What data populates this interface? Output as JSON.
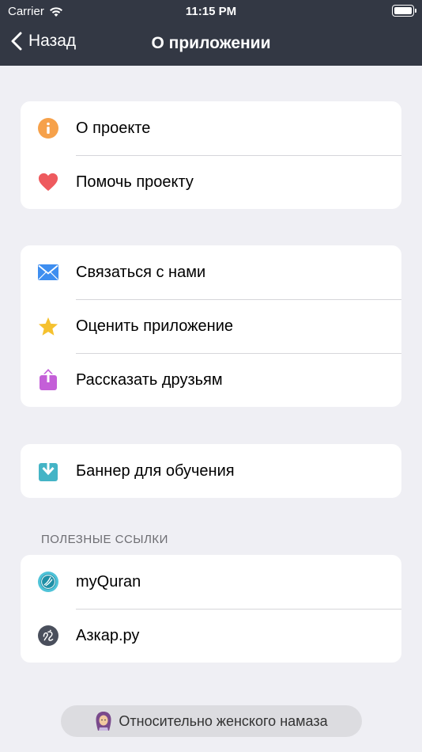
{
  "status_bar": {
    "carrier": "Carrier",
    "time": "11:15 PM"
  },
  "nav": {
    "back_label": "Назад",
    "title": "О приложении"
  },
  "groups": [
    {
      "items": [
        {
          "label": "О проекте",
          "icon": "info-icon"
        },
        {
          "label": "Помочь проекту",
          "icon": "heart-icon"
        }
      ]
    },
    {
      "items": [
        {
          "label": "Связаться с нами",
          "icon": "mail-icon"
        },
        {
          "label": "Оценить приложение",
          "icon": "star-icon"
        },
        {
          "label": "Рассказать друзьям",
          "icon": "share-icon"
        }
      ]
    },
    {
      "items": [
        {
          "label": "Баннер для обучения",
          "icon": "download-icon"
        }
      ]
    }
  ],
  "useful_links": {
    "header": "ПОЛЕЗНЫЕ ССЫЛКИ",
    "items": [
      {
        "label": "myQuran",
        "icon": "myquran-icon"
      },
      {
        "label": "Азкар.ру",
        "icon": "azkar-icon"
      }
    ]
  },
  "footer_button": {
    "label": "Относительно женского намаза",
    "icon": "woman-hijab-icon"
  },
  "colors": {
    "nav_bg": "#333844",
    "info": "#f6a14a",
    "heart": "#ee5a5e",
    "mail": "#3e8ef0",
    "star": "#f5c12e",
    "share": "#c45fd8",
    "download": "#44b4c6"
  }
}
